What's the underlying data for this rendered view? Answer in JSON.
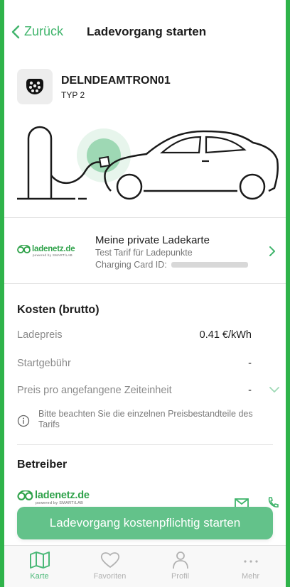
{
  "nav": {
    "back_label": "Zurück",
    "title": "Ladevorgang starten"
  },
  "station": {
    "name": "DELNDEAMTRON01",
    "type": "TYP 2",
    "plug_icon": "type2-plug-icon"
  },
  "card": {
    "brand_name": "ladenetz.de",
    "brand_sub": "powered by SMART/LAB",
    "title": "Meine private Ladekarte",
    "tariff": "Test Tarif für Ladepunkte",
    "id_label": "Charging Card ID:"
  },
  "costs": {
    "title": "Kosten (brutto)",
    "rows": [
      {
        "label": "Ladepreis",
        "value": "0.41 €/kWh"
      },
      {
        "label": "Startgebühr",
        "value": "-"
      },
      {
        "label": "Preis pro angefangene Zeiteinheit",
        "value": "-"
      }
    ],
    "note": "Bitte beachten Sie die einzelnen Preisbestandteile des Tarifs"
  },
  "operator": {
    "title": "Betreiber",
    "brand_name": "ladenetz.de",
    "brand_sub": "powered by SMART/LAB"
  },
  "cta_label": "Ladevorgang kostenpflichtig starten",
  "tabs": [
    {
      "label": "Karte",
      "icon": "map-icon",
      "active": true
    },
    {
      "label": "Favoriten",
      "icon": "heart-icon",
      "active": false
    },
    {
      "label": "Profil",
      "icon": "person-icon",
      "active": false
    },
    {
      "label": "Mehr",
      "icon": "more-icon",
      "active": false
    }
  ],
  "colors": {
    "frame_green": "#2fb34a",
    "accent": "#3fb46b",
    "cta": "#63c28a",
    "brand": "#2fa24a"
  }
}
